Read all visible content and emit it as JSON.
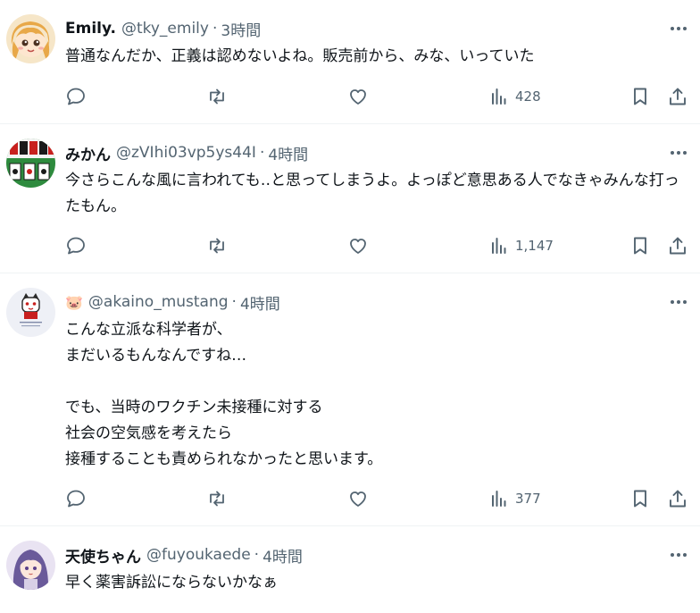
{
  "colors": {
    "text": "#0f1419",
    "secondary": "#536471",
    "divider": "#eff3f4"
  },
  "icons": {
    "reply": "reply-icon",
    "retweet": "retweet-icon",
    "like": "like-icon",
    "views": "views-icon",
    "bookmark": "bookmark-icon",
    "share": "share-icon",
    "more": "more-icon"
  },
  "tweets": [
    {
      "name": "Emily.",
      "handle": "@tky_emily",
      "sep": "·",
      "time": "3時間",
      "text": "普通なんだか、正義は認めないよね。販売前から、みな、いっていた",
      "views": "428"
    },
    {
      "name": "みかん",
      "handle": "@zVIhi03vp5ys44I",
      "sep": "·",
      "time": "4時間",
      "text": "今さらこんな風に言われても‥と思ってしまうよ。よっぽど意思ある人でなきゃみんな打ったもん。",
      "views": "1,147"
    },
    {
      "name": "🐷",
      "handle": "@akaino_mustang",
      "sep": "·",
      "time": "4時間",
      "text": "こんな立派な科学者が、\nまだいるもんなんですね…\n\nでも、当時のワクチン未接種に対する\n社会の空気感を考えたら\n接種することも責められなかったと思います。",
      "views": "377"
    },
    {
      "name": "天使ちゃん",
      "handle": "@fuyoukaede",
      "sep": "·",
      "time": "4時間",
      "text": "早く薬害訴訟にならないかなぁ"
    }
  ]
}
